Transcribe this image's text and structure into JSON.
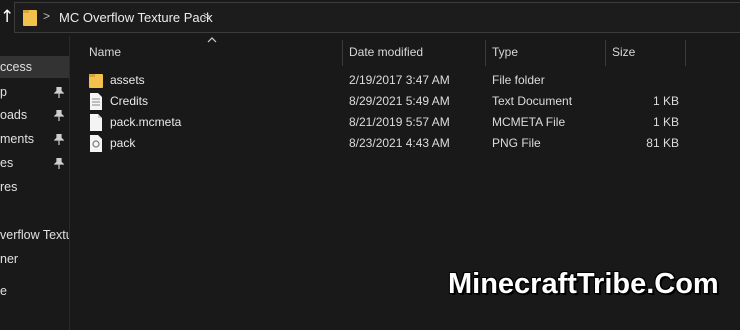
{
  "address_bar": {
    "up_glyph": "↑",
    "separator": ">",
    "crumb": "MC Overflow Texture Pack"
  },
  "sort_glyph": "^",
  "nav": {
    "items": [
      {
        "label": "ccess",
        "pinned": false,
        "selected": true
      },
      {
        "label": "p",
        "pinned": true
      },
      {
        "label": "oads",
        "pinned": true
      },
      {
        "label": "ments",
        "pinned": true
      },
      {
        "label": "es",
        "pinned": true
      },
      {
        "label": "res",
        "pinned": false
      },
      {
        "label": "verflow Textur",
        "pinned": false
      },
      {
        "label": "ner",
        "pinned": false
      },
      {
        "label": "e",
        "pinned": false
      }
    ]
  },
  "columns": {
    "name": "Name",
    "date": "Date modified",
    "type": "Type",
    "size": "Size"
  },
  "files": [
    {
      "name": "assets",
      "date": "2/19/2017 3:47 AM",
      "type": "File folder",
      "size": "",
      "icon": "folder-icon"
    },
    {
      "name": "Credits",
      "date": "8/29/2021 5:49 AM",
      "type": "Text Document",
      "size": "1 KB",
      "icon": "text-file-icon"
    },
    {
      "name": "pack.mcmeta",
      "date": "8/21/2019 5:57 AM",
      "type": "MCMETA File",
      "size": "1 KB",
      "icon": "generic-file-icon"
    },
    {
      "name": "pack",
      "date": "8/23/2021 4:43 AM",
      "type": "PNG File",
      "size": "81 KB",
      "icon": "image-file-icon"
    }
  ],
  "watermark": "MinecraftTribe.Com",
  "colors": {
    "background": "#191919",
    "folder": "#f2c14e",
    "selected": "#333333"
  }
}
